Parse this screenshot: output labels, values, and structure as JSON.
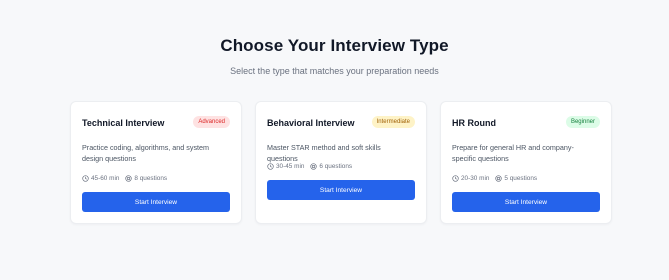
{
  "header": {
    "title": "Choose Your Interview Type",
    "subtitle": "Select the type that matches your preparation needs"
  },
  "cards": [
    {
      "title": "Technical Interview",
      "level": "Advanced",
      "level_color": "#dc2626",
      "description": "Practice coding, algorithms, and system design questions",
      "duration": "45-60 min",
      "questions": "8 questions",
      "button_label": "Start Interview"
    },
    {
      "title": "Behavioral Interview",
      "level": "Intermediate",
      "level_color": "#a16207",
      "description": "Master STAR method and soft skills questions",
      "duration": "30-45 min",
      "questions": "6 questions",
      "button_label": "Start Interview"
    },
    {
      "title": "HR Round",
      "level": "Beginner",
      "level_color": "#15803d",
      "description": "Prepare for general HR and company-specific questions",
      "duration": "20-30 min",
      "questions": "5 questions",
      "button_label": "Start Interview"
    }
  ],
  "colors": {
    "accent": "#2563eb",
    "background": "#f7f8fa"
  },
  "icons": {
    "duration": "clock-icon",
    "questions": "target-icon"
  }
}
